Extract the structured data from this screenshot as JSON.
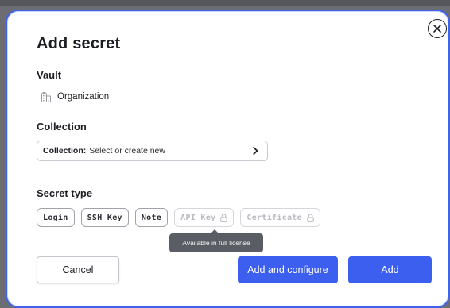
{
  "dialog": {
    "title": "Add secret",
    "close_icon": "close-circle-icon"
  },
  "vault": {
    "label": "Vault",
    "icon": "building-icon",
    "value": "Organization"
  },
  "collection": {
    "label": "Collection",
    "field_prefix": "Collection:",
    "field_value": "Select or create new",
    "chevron_icon": "chevron-right-icon"
  },
  "secret_type": {
    "label": "Secret type",
    "options": [
      {
        "label": "Login",
        "enabled": true
      },
      {
        "label": "SSH Key",
        "enabled": true
      },
      {
        "label": "Note",
        "enabled": true
      },
      {
        "label": "API Key",
        "enabled": false,
        "icon": "lock-icon"
      },
      {
        "label": "Certificate",
        "enabled": false,
        "icon": "lock-icon"
      }
    ],
    "tooltip": "Available in full license"
  },
  "buttons": {
    "cancel": "Cancel",
    "add_and_configure": "Add and configure",
    "add": "Add"
  },
  "colors": {
    "primary": "#3d5ff0",
    "modal_border": "#3f63ea",
    "tooltip_bg": "#5a5d63",
    "backdrop": "#6b6d72"
  }
}
